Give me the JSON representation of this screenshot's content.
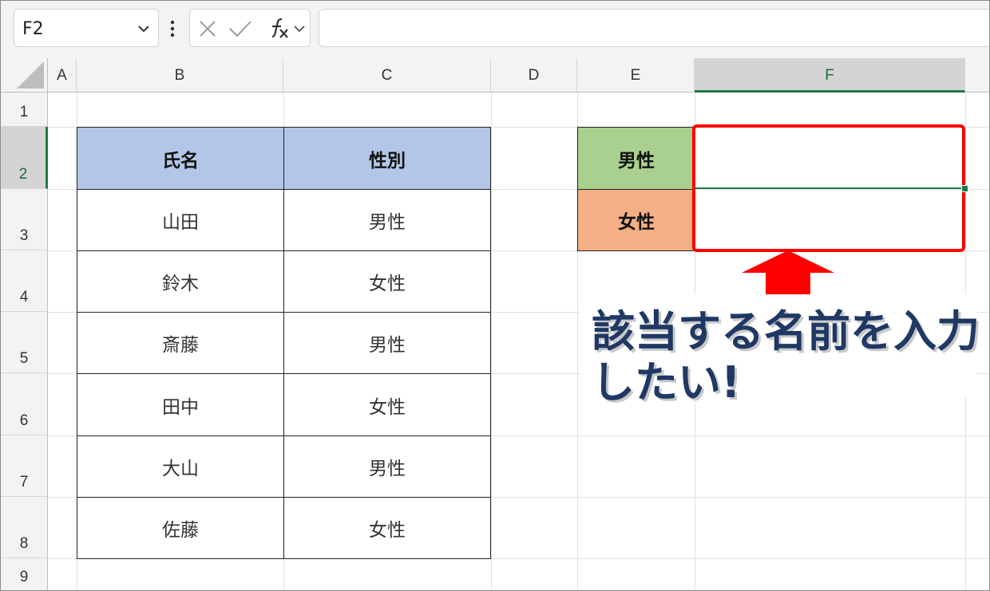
{
  "formula_bar": {
    "name_box": "F2",
    "formula_value": ""
  },
  "columns": [
    "A",
    "B",
    "C",
    "D",
    "E",
    "F"
  ],
  "selected_column": "F",
  "rows": [
    "1",
    "2",
    "3",
    "4",
    "5",
    "6",
    "7",
    "8",
    "9"
  ],
  "selected_row": "2",
  "table": {
    "headers": [
      "氏名",
      "性別"
    ],
    "rows": [
      [
        "山田",
        "男性"
      ],
      [
        "鈴木",
        "女性"
      ],
      [
        "斎藤",
        "男性"
      ],
      [
        "田中",
        "女性"
      ],
      [
        "大山",
        "男性"
      ],
      [
        "佐藤",
        "女性"
      ]
    ]
  },
  "summary": {
    "male_label": "男性",
    "female_label": "女性",
    "male_value": "",
    "female_value": ""
  },
  "annotation": {
    "line1": "該当する名前を入力",
    "line2": "したい!"
  },
  "colors": {
    "header_fill": "#b4c6e7",
    "male_fill": "#a9d08e",
    "female_fill": "#f4b084",
    "highlight": "#ff0000",
    "selection": "#1e7a45",
    "callout_text": "#1f3864"
  }
}
